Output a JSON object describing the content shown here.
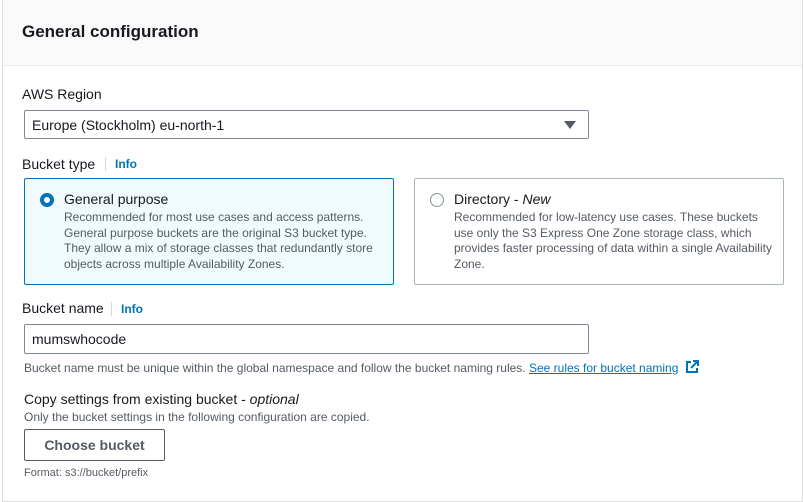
{
  "panel": {
    "title": "General configuration"
  },
  "region": {
    "label": "AWS Region",
    "value": "Europe (Stockholm) eu-north-1"
  },
  "bucket_type": {
    "label": "Bucket type",
    "info": "Info",
    "options": [
      {
        "title": "General purpose",
        "tag": "",
        "selected": true,
        "description": "Recommended for most use cases and access patterns. General purpose buckets are the original S3 bucket type. They allow a mix of storage classes that redundantly store objects across multiple Availability Zones."
      },
      {
        "title": "Directory - ",
        "tag": "New",
        "selected": false,
        "description": "Recommended for low-latency use cases. These buckets use only the S3 Express One Zone storage class, which provides faster processing of data within a single Availability Zone."
      }
    ]
  },
  "bucket_name": {
    "label": "Bucket name",
    "info": "Info",
    "value": "mumswhocode",
    "hint": "Bucket name must be unique within the global namespace and follow the bucket naming rules.",
    "rules_link": "See rules for bucket naming"
  },
  "copy_settings": {
    "label": "Copy settings from existing bucket - ",
    "optional": "optional",
    "description": "Only the bucket settings in the following configuration are copied.",
    "button": "Choose bucket",
    "format": "Format: s3://bucket/prefix"
  },
  "colors": {
    "accent": "#0073bb",
    "text": "#16191f",
    "muted": "#545b64"
  }
}
